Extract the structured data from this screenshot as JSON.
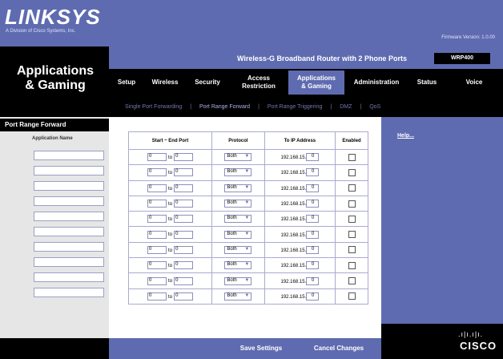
{
  "brand": {
    "logo": "LINKSYS",
    "logo_sub": "A Division of Cisco Systems, Inc.",
    "firmware": "Firmware Version: 1.0.00"
  },
  "section": {
    "title_line1": "Applications",
    "title_line2": "& Gaming"
  },
  "product": {
    "name": "Wireless-G Broadband Router with 2 Phone Ports",
    "model": "WRP400"
  },
  "tabs": [
    {
      "label": "Setup"
    },
    {
      "label": "Wireless"
    },
    {
      "label": "Security"
    },
    {
      "label": "Access Restriction"
    },
    {
      "label": "Applications & Gaming"
    },
    {
      "label": "Administration"
    },
    {
      "label": "Status"
    },
    {
      "label": "Voice"
    }
  ],
  "subtabs": [
    {
      "label": "Single Port Forwarding"
    },
    {
      "label": "Port Range Forward"
    },
    {
      "label": "Port Range Triggering"
    },
    {
      "label": "DMZ"
    },
    {
      "label": "QoS"
    }
  ],
  "left": {
    "heading": "Port Range Forward",
    "app_name_label": "Application Name"
  },
  "table": {
    "headers": [
      "Start ~ End Port",
      "Protocol",
      "To IP Address",
      "Enabled"
    ],
    "to_label": "to",
    "ip_prefix": "192.168.15.",
    "protocol_selected": "Both",
    "rows": [
      {
        "start": "0",
        "end": "0",
        "ip_last": "0"
      },
      {
        "start": "0",
        "end": "0",
        "ip_last": "0"
      },
      {
        "start": "0",
        "end": "0",
        "ip_last": "0"
      },
      {
        "start": "0",
        "end": "0",
        "ip_last": "0"
      },
      {
        "start": "0",
        "end": "0",
        "ip_last": "0"
      },
      {
        "start": "0",
        "end": "0",
        "ip_last": "0"
      },
      {
        "start": "0",
        "end": "0",
        "ip_last": "0"
      },
      {
        "start": "0",
        "end": "0",
        "ip_last": "0"
      },
      {
        "start": "0",
        "end": "0",
        "ip_last": "0"
      },
      {
        "start": "0",
        "end": "0",
        "ip_last": "0"
      }
    ]
  },
  "help": {
    "label": "Help..."
  },
  "footer": {
    "save": "Save Settings",
    "cancel": "Cancel Changes",
    "cisco": "CISCO"
  },
  "colors": {
    "accent": "#5f6bb0",
    "dark": "#000000"
  }
}
